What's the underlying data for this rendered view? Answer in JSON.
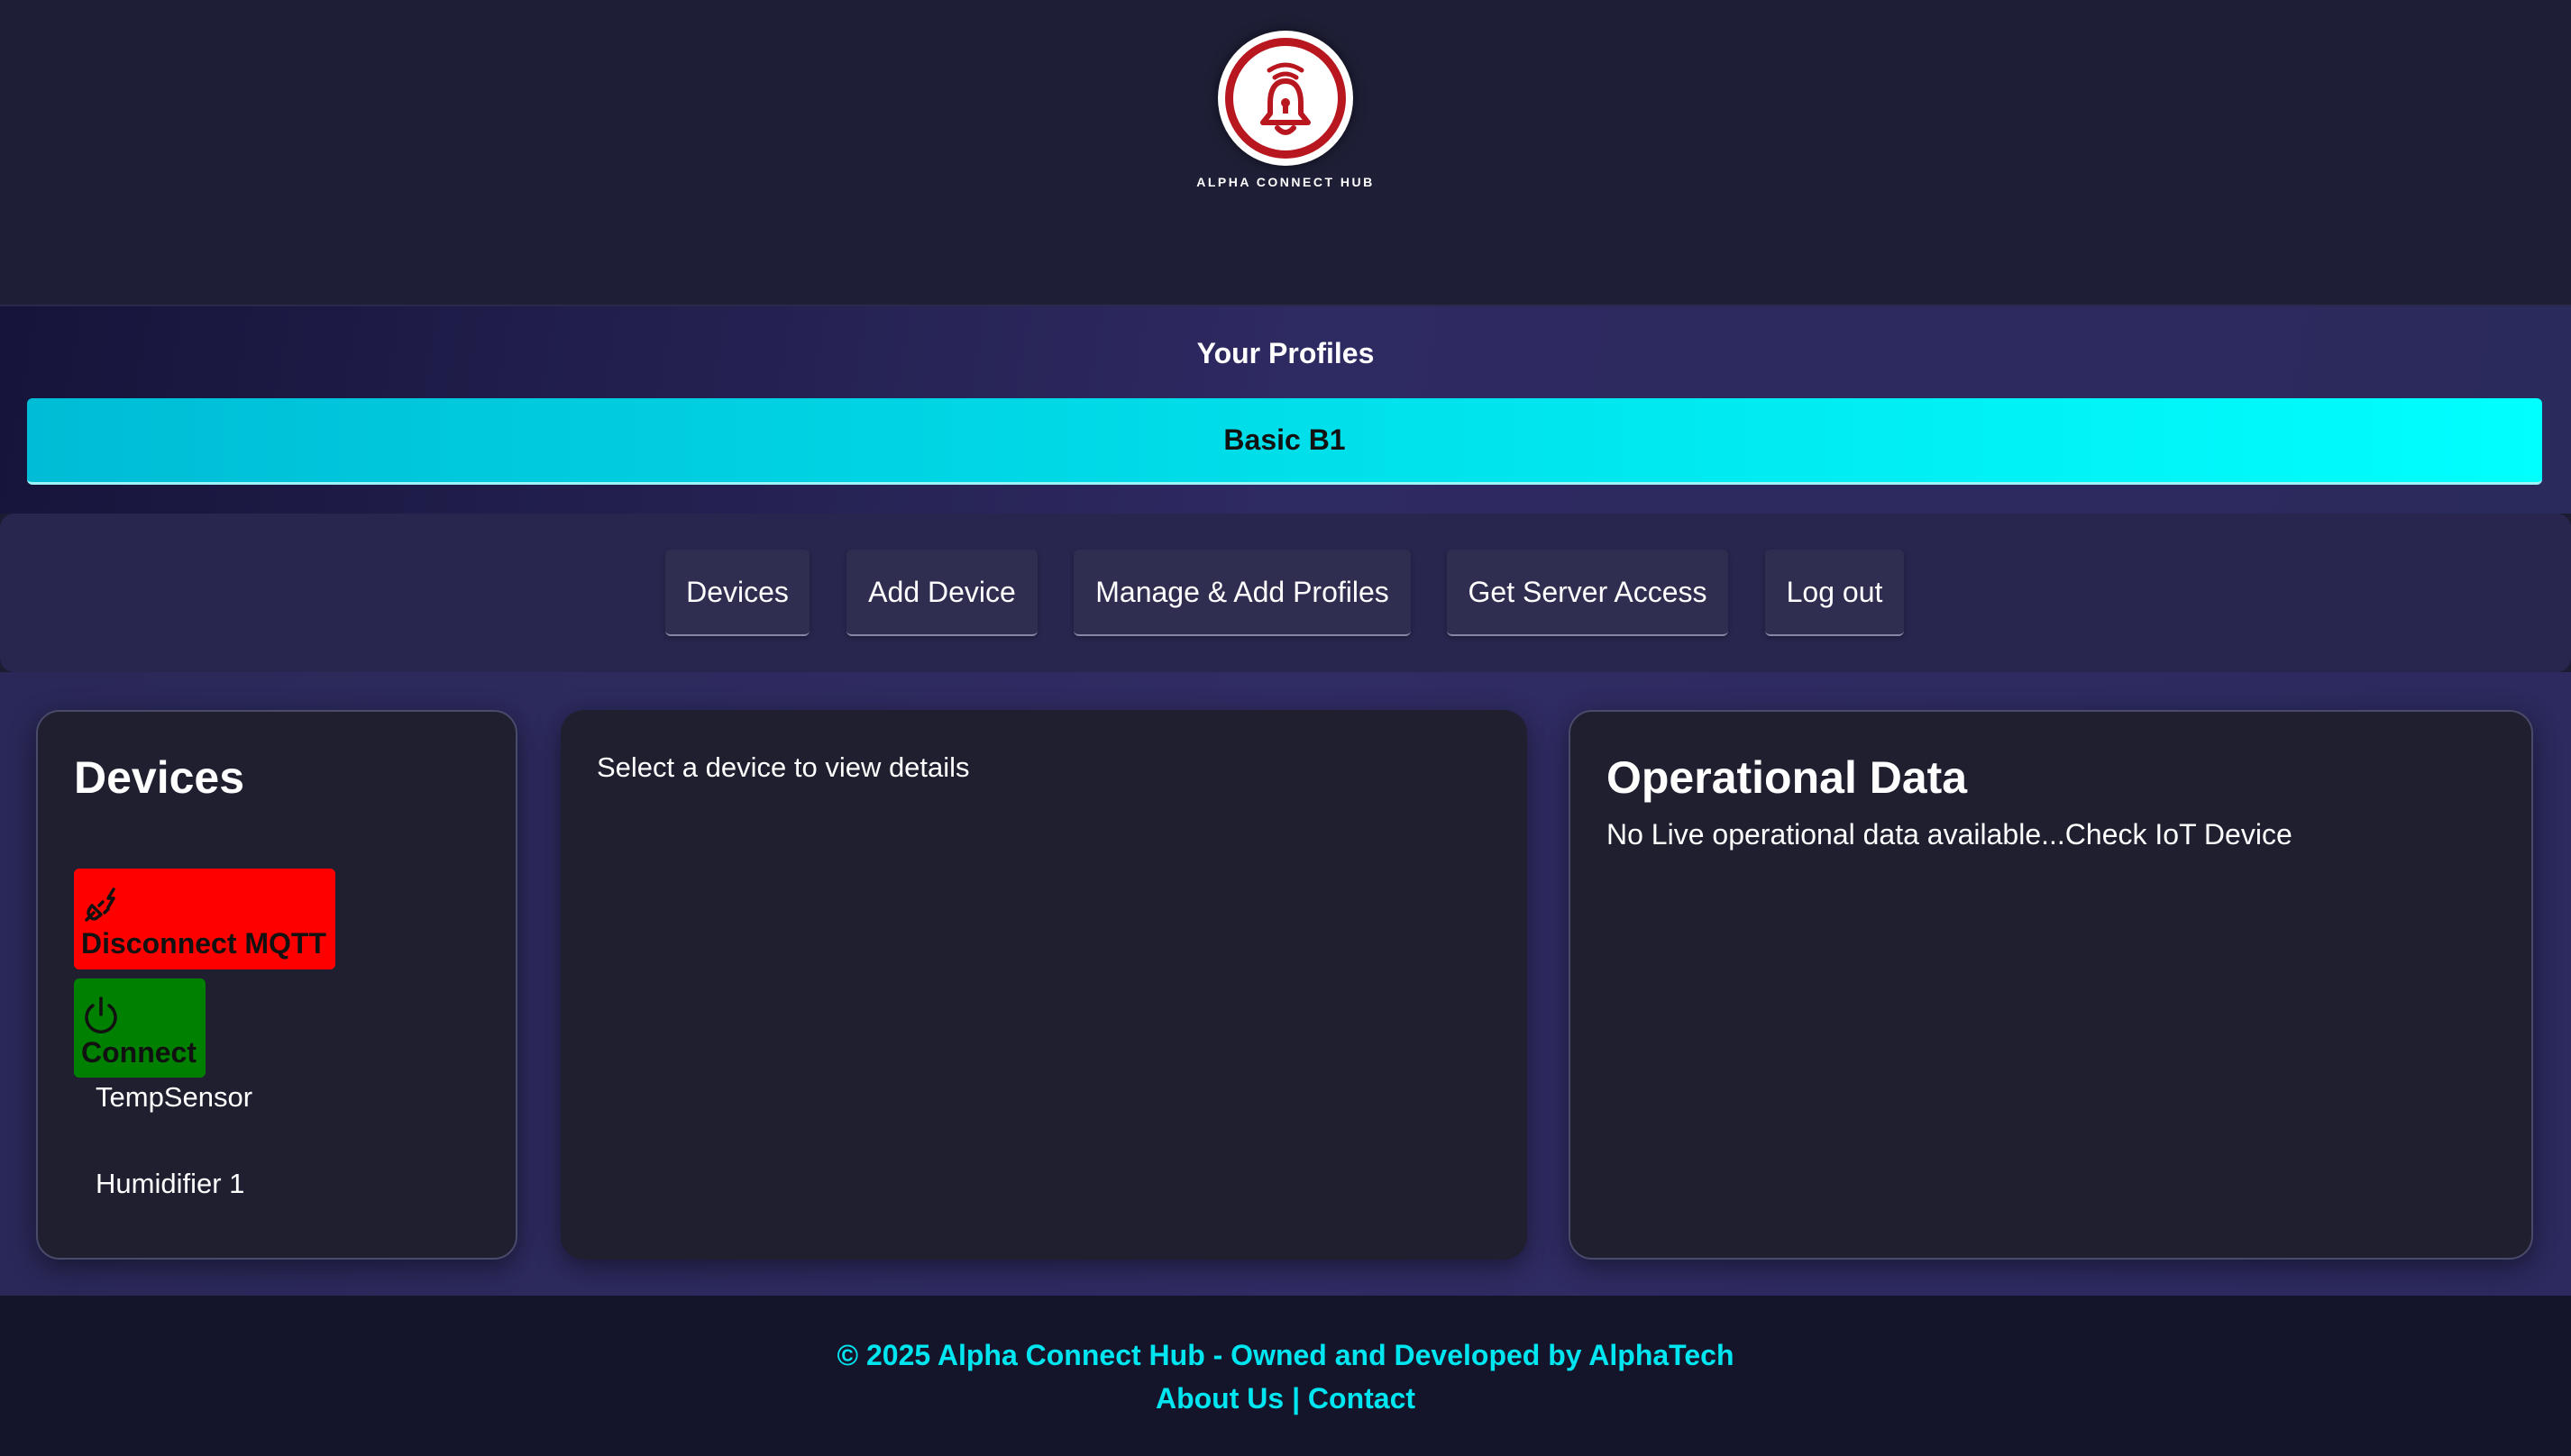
{
  "header": {
    "logo_text": "ALPHA CONNECT HUB",
    "logo_icon": "bell-wifi-icon",
    "brand_color": "#b8171f"
  },
  "profiles": {
    "title": "Your Profiles",
    "items": [
      {
        "label": "Basic B1"
      }
    ],
    "accent_color": "#00e2ec"
  },
  "nav": {
    "items": [
      {
        "label": "Devices"
      },
      {
        "label": "Add Device"
      },
      {
        "label": "Manage & Add Profiles"
      },
      {
        "label": "Get Server Access"
      },
      {
        "label": "Log out"
      }
    ]
  },
  "devices_panel": {
    "title": "Devices",
    "disconnect_button": {
      "label": "Disconnect MQTT",
      "icon": "unplug-icon",
      "color": "#ff0000"
    },
    "connect_button": {
      "label": "Connect",
      "icon": "power-icon",
      "color": "#008000"
    },
    "devices": [
      {
        "name": "TempSensor"
      },
      {
        "name": "Humidifier 1"
      }
    ]
  },
  "details_panel": {
    "placeholder": "Select a device to view details"
  },
  "operational_panel": {
    "title": "Operational Data",
    "message": "No Live operational data available...Check IoT Device"
  },
  "footer": {
    "copyright": "© 2025 Alpha Connect Hub - Owned and Developed by AlphaTech",
    "about_label": "About Us",
    "separator": "|",
    "contact_label": "Contact",
    "link_color": "#00e6f0"
  }
}
